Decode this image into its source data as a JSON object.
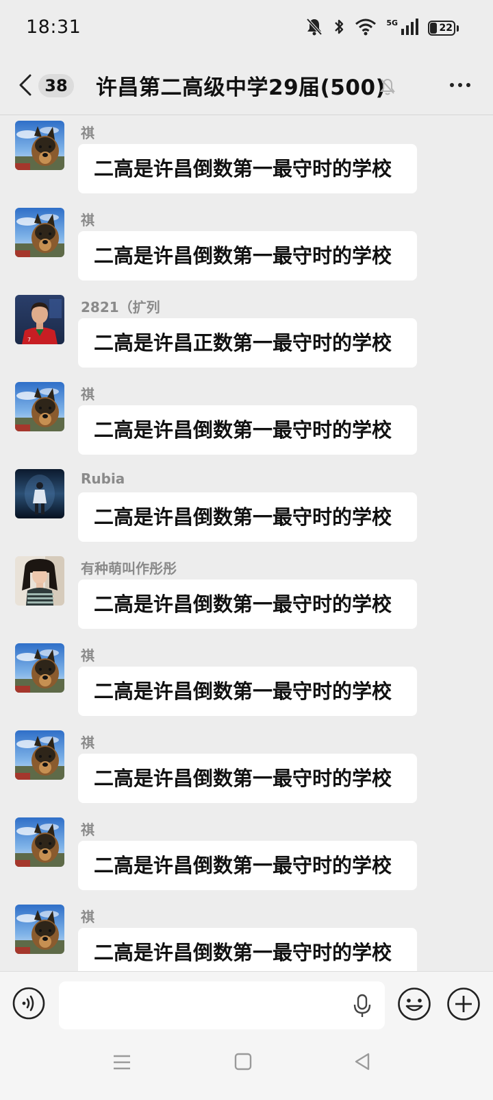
{
  "status_bar": {
    "time": "18:31",
    "network": "5G",
    "battery": "22",
    "icons": [
      "bell-off-icon",
      "bluetooth-icon",
      "wifi-icon",
      "signal-icon",
      "battery-icon"
    ]
  },
  "header": {
    "unread_count": "38",
    "title": "许昌第二高级中学29届(500)",
    "icons": [
      "back-arrow-icon",
      "mute-bell-icon",
      "more-dots-icon"
    ]
  },
  "messages": [
    {
      "sender": "祺",
      "text": "二高是许昌倒数第一最守时的学校",
      "avatar": "dog"
    },
    {
      "sender": "祺",
      "text": "二高是许昌倒数第一最守时的学校",
      "avatar": "dog"
    },
    {
      "sender": "2821（扩列",
      "text": "二高是许昌正数第一最守时的学校",
      "avatar": "soccer"
    },
    {
      "sender": "祺",
      "text": "二高是许昌倒数第一最守时的学校",
      "avatar": "dog"
    },
    {
      "sender": "Rubia",
      "text": "二高是许昌倒数第一最守时的学校",
      "avatar": "night"
    },
    {
      "sender": "有种萌叫作彤彤",
      "text": "二高是许昌倒数第一最守时的学校",
      "avatar": "girl"
    },
    {
      "sender": "祺",
      "text": "二高是许昌倒数第一最守时的学校",
      "avatar": "dog"
    },
    {
      "sender": "祺",
      "text": "二高是许昌倒数第一最守时的学校",
      "avatar": "dog"
    },
    {
      "sender": "祺",
      "text": "二高是许昌倒数第一最守时的学校",
      "avatar": "dog"
    },
    {
      "sender": "祺",
      "text": "二高是许昌倒数第一最守时的学校",
      "avatar": "dog"
    }
  ],
  "input_bar": {
    "text_value": "",
    "icons": [
      "voice-mode-icon",
      "microphone-icon",
      "emoji-icon",
      "plus-icon"
    ]
  },
  "nav_bar": {
    "icons": [
      "menu-icon",
      "home-icon",
      "back-icon"
    ]
  },
  "colors": {
    "background": "#ededed",
    "bubble": "#ffffff",
    "sender_name": "#8a8a8a",
    "text": "#111111"
  }
}
